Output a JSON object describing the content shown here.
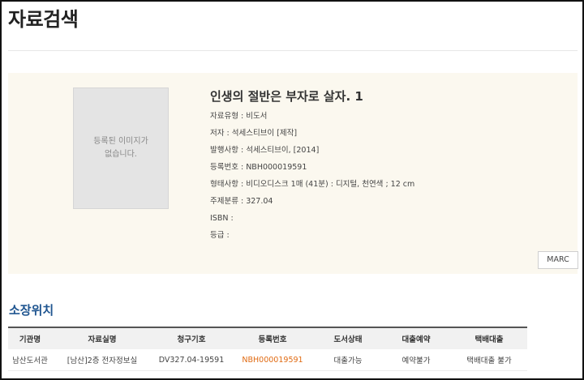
{
  "page": {
    "title": "자료검색"
  },
  "record": {
    "thumbnail_text": "등록된 이미지가\n없습니다.",
    "title": "인생의 절반은 부자로 살자. 1",
    "fields": [
      "자료유형 : 비도서",
      "저자 : 석세스티브이 [제작]",
      "발행사항 : 석세스티브이, [2014]",
      "등록번호 : NBH000019591",
      "형태사항 : 비디오디스크 1매 (41분) : 디지털, 천연색 ; 12 cm",
      "주제분류 : 327.04",
      "ISBN :",
      "등급 :"
    ],
    "marc_label": "MARC"
  },
  "holdings": {
    "section_title": "소장위치",
    "columns": [
      "기관명",
      "자료실명",
      "청구기호",
      "등록번호",
      "도서상태",
      "대출예약",
      "택배대출"
    ],
    "rows": [
      [
        "남산도서관",
        "[남산]2층 전자정보실",
        "DV327.04-19591",
        "NBH000019591",
        "대출가능",
        "예약불가",
        "택배대출 불가"
      ]
    ]
  },
  "colors": {
    "section_title": "#1f5590",
    "registration_link": "#e06a12",
    "panel_background": "#fbf8ef"
  }
}
